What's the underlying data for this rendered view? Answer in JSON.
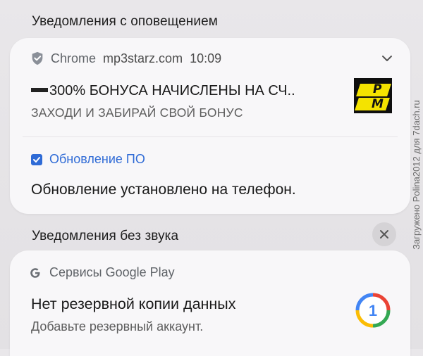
{
  "section_alerting": {
    "title": "Уведомления с оповещением"
  },
  "chrome_notification": {
    "app": "Chrome",
    "site": "mp3starz.com",
    "time": "10:09",
    "title": "300% БОНУСА НАЧИСЛЕНЫ НА СЧ..",
    "subtitle": "ЗАХОДИ И ЗАБИРАЙ СВОЙ БОНУС",
    "logo_text_top": "P",
    "logo_text_bottom": "M"
  },
  "system_update": {
    "app": "Обновление ПО",
    "message": "Обновление установлено на телефон."
  },
  "section_silent": {
    "title": "Уведомления без звука"
  },
  "google_play_notification": {
    "app": "Сервисы Google Play",
    "title": "Нет резервной копии данных",
    "subtitle": "Добавьте резервный аккаунт.",
    "icon_digit": "1"
  },
  "watermark": {
    "text": "Загружено Polina2012 для 7dach.ru"
  },
  "colors": {
    "accent_blue": "#2f6bd6",
    "brand_yellow": "#f4e300",
    "card_bg": "#f8f7f9"
  }
}
